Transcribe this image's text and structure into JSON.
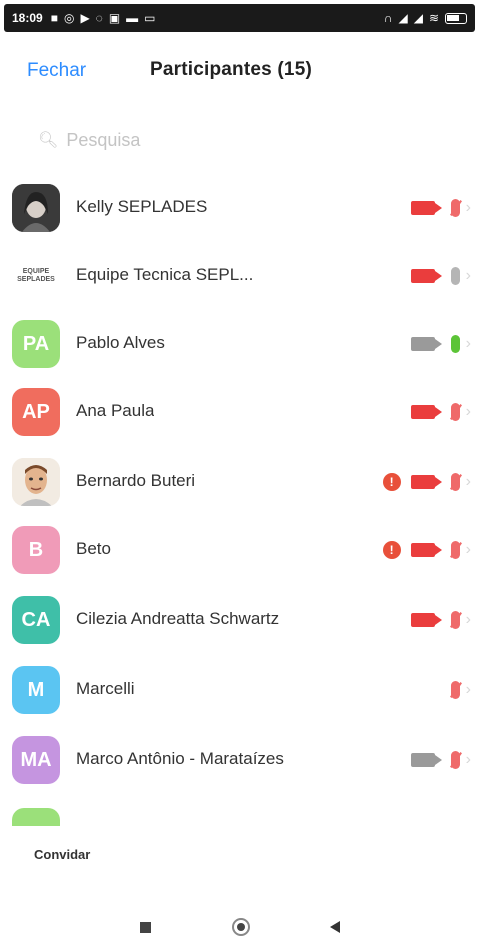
{
  "status_bar": {
    "time": "18:09",
    "left_icons": [
      "notification-icon",
      "whatsapp-icon",
      "play-icon",
      "app-icon",
      "gallery-icon",
      "cast-icon",
      "message-icon"
    ],
    "right_icons": [
      "headset-icon",
      "signal-icon",
      "signal-icon",
      "wifi-icon",
      "battery-icon"
    ]
  },
  "header": {
    "close_label": "Fechar",
    "title": "Participantes (15)"
  },
  "search": {
    "placeholder": "Pesquisa"
  },
  "participants": [
    {
      "name": "Kelly SEPLADES",
      "avatar": "photo",
      "initials": "",
      "avatar_color": "#4b4b4b",
      "video": "red",
      "mic": "red-muted",
      "alert": false
    },
    {
      "name": "Equipe Tecnica SEPL...",
      "avatar": "logo",
      "initials": "EQUIPE SEPLADES",
      "avatar_color": "#ffffff",
      "video": "red",
      "mic": "gray",
      "alert": false
    },
    {
      "name": "Pablo Alves",
      "avatar": "initials",
      "initials": "PA",
      "avatar_color": "#9be07a",
      "video": "gray",
      "mic": "green",
      "alert": false
    },
    {
      "name": "Ana Paula",
      "avatar": "initials",
      "initials": "AP",
      "avatar_color": "#f06d5e",
      "video": "red",
      "mic": "red-muted",
      "alert": false
    },
    {
      "name": "Bernardo Buteri",
      "avatar": "photo",
      "initials": "",
      "avatar_color": "#e8c9a8",
      "video": "red",
      "mic": "red-muted",
      "alert": true
    },
    {
      "name": "Beto",
      "avatar": "initials",
      "initials": "B",
      "avatar_color": "#f09bb8",
      "video": "red",
      "mic": "red-muted",
      "alert": true
    },
    {
      "name": "Cilezia Andreatta Schwartz",
      "avatar": "initials",
      "initials": "CA",
      "avatar_color": "#3fbfa8",
      "video": "red",
      "mic": "red-muted",
      "alert": false
    },
    {
      "name": "Marcelli",
      "avatar": "initials",
      "initials": "M",
      "avatar_color": "#5bc5f2",
      "video": "none",
      "mic": "red-muted",
      "alert": false
    },
    {
      "name": "Marco Antônio - Marataízes",
      "avatar": "initials",
      "initials": "MA",
      "avatar_color": "#c595e0",
      "video": "gray",
      "mic": "red-muted",
      "alert": false
    }
  ],
  "footer": {
    "invite_label": "Convidar"
  },
  "colors": {
    "accent": "#2d8cff",
    "video_on": "#ea3d3d",
    "mic_muted": "#ef6a6a",
    "mic_on": "#5cc437"
  }
}
